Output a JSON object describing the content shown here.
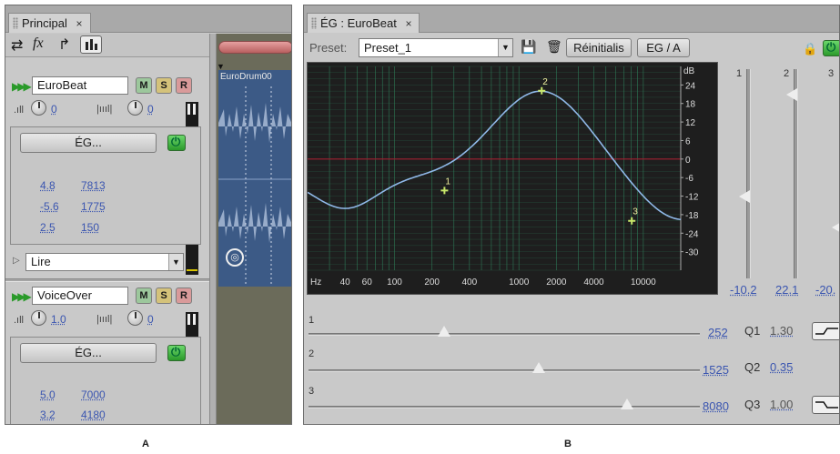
{
  "panel_a": {
    "tab_label": "Principal",
    "tab_close": "×",
    "toolbar_icons": [
      "swap-icon",
      "fx-icon",
      "routing-icon",
      "meters-icon"
    ],
    "timeline_clip": "EuroDrum00",
    "tracks": [
      {
        "name": "EuroBeat",
        "m": "M",
        "s": "S",
        "r": "R",
        "volume": "0",
        "pan": "0",
        "effect_button": "ÉG...",
        "values": [
          [
            "4.8",
            "7813"
          ],
          [
            "-5.6",
            "1775"
          ],
          [
            "2.5",
            "150"
          ]
        ],
        "mode": "Lire"
      },
      {
        "name": "VoiceOver",
        "m": "M",
        "s": "S",
        "r": "R",
        "volume": "1.0",
        "pan": "0",
        "effect_button": "ÉG...",
        "values": [
          [
            "5.0",
            "7000"
          ],
          [
            "3.2",
            "4180"
          ]
        ]
      }
    ]
  },
  "panel_b": {
    "tab_label": "ÉG : EuroBeat",
    "tab_close": "×",
    "preset_label": "Preset:",
    "preset_value": "Preset_1",
    "reset_button": "Réinitialis",
    "eqa_button": "EG / A",
    "band_column_labels": [
      "1",
      "2",
      "3"
    ],
    "band_gains": [
      "-10.2",
      "22.1",
      "-20."
    ],
    "band_gain_levels": [
      -10.2,
      22.1,
      -20
    ],
    "bands": [
      {
        "label": "1",
        "freq": "252",
        "q_label": "Q1",
        "q_value": "1.30"
      },
      {
        "label": "2",
        "freq": "1525",
        "q_label": "Q2",
        "q_value": "0.35"
      },
      {
        "label": "3",
        "freq": "8080",
        "q_label": "Q3",
        "q_value": "1.00"
      }
    ],
    "graph": {
      "y_unit": "dB",
      "y_ticks": [
        "24",
        "18",
        "12",
        "6",
        "0",
        "-6",
        "-12",
        "-18",
        "-24",
        "-30"
      ],
      "x_unit": "Hz",
      "x_ticks": [
        "40",
        "60",
        "100",
        "200",
        "400",
        "1000",
        "2000",
        "4000",
        "10000"
      ],
      "band_points": [
        {
          "label": "1",
          "freq": 252,
          "gain": -10.2
        },
        {
          "label": "2",
          "freq": 1525,
          "gain": 22.1
        },
        {
          "label": "3",
          "freq": 8080,
          "gain": -20
        }
      ]
    }
  },
  "captions": {
    "a": "A",
    "b": "B"
  },
  "colors": {
    "graph_bg": "#1e1e1e",
    "grid": "#2f7f5a",
    "curve": "#8fb8e8",
    "point": "#c8e86a",
    "zero_line": "#a02030",
    "link": "#3a55b0",
    "power": "#2fae2f"
  }
}
